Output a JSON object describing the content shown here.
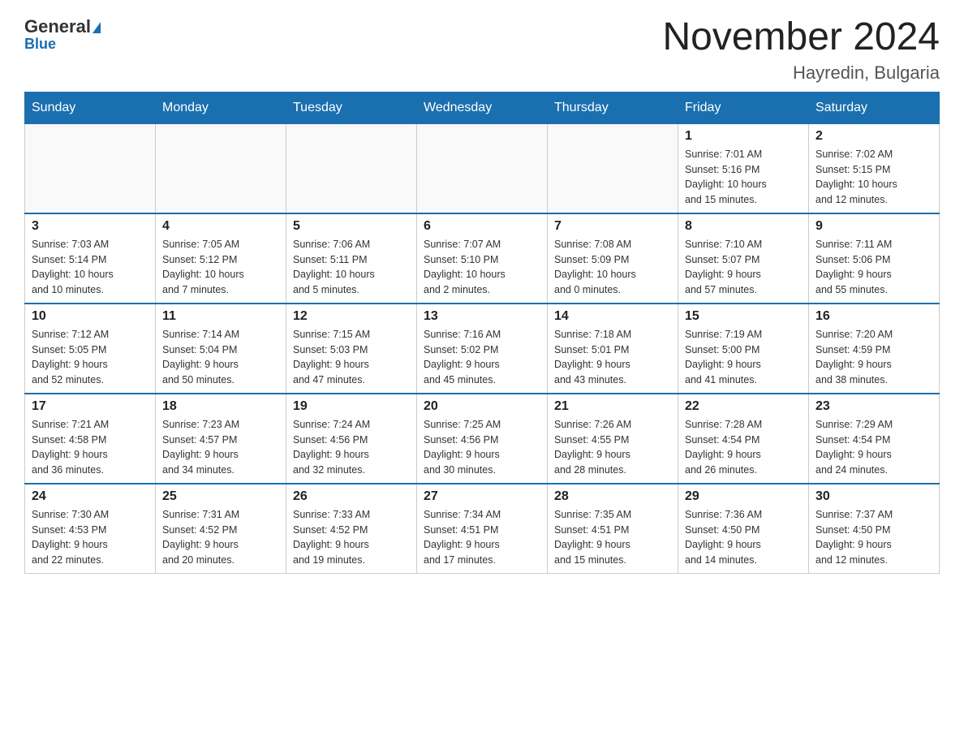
{
  "header": {
    "logo_general": "General",
    "logo_blue": "Blue",
    "main_title": "November 2024",
    "subtitle": "Hayredin, Bulgaria"
  },
  "weekdays": [
    "Sunday",
    "Monday",
    "Tuesday",
    "Wednesday",
    "Thursday",
    "Friday",
    "Saturday"
  ],
  "weeks": [
    [
      {
        "day": "",
        "info": ""
      },
      {
        "day": "",
        "info": ""
      },
      {
        "day": "",
        "info": ""
      },
      {
        "day": "",
        "info": ""
      },
      {
        "day": "",
        "info": ""
      },
      {
        "day": "1",
        "info": "Sunrise: 7:01 AM\nSunset: 5:16 PM\nDaylight: 10 hours\nand 15 minutes."
      },
      {
        "day": "2",
        "info": "Sunrise: 7:02 AM\nSunset: 5:15 PM\nDaylight: 10 hours\nand 12 minutes."
      }
    ],
    [
      {
        "day": "3",
        "info": "Sunrise: 7:03 AM\nSunset: 5:14 PM\nDaylight: 10 hours\nand 10 minutes."
      },
      {
        "day": "4",
        "info": "Sunrise: 7:05 AM\nSunset: 5:12 PM\nDaylight: 10 hours\nand 7 minutes."
      },
      {
        "day": "5",
        "info": "Sunrise: 7:06 AM\nSunset: 5:11 PM\nDaylight: 10 hours\nand 5 minutes."
      },
      {
        "day": "6",
        "info": "Sunrise: 7:07 AM\nSunset: 5:10 PM\nDaylight: 10 hours\nand 2 minutes."
      },
      {
        "day": "7",
        "info": "Sunrise: 7:08 AM\nSunset: 5:09 PM\nDaylight: 10 hours\nand 0 minutes."
      },
      {
        "day": "8",
        "info": "Sunrise: 7:10 AM\nSunset: 5:07 PM\nDaylight: 9 hours\nand 57 minutes."
      },
      {
        "day": "9",
        "info": "Sunrise: 7:11 AM\nSunset: 5:06 PM\nDaylight: 9 hours\nand 55 minutes."
      }
    ],
    [
      {
        "day": "10",
        "info": "Sunrise: 7:12 AM\nSunset: 5:05 PM\nDaylight: 9 hours\nand 52 minutes."
      },
      {
        "day": "11",
        "info": "Sunrise: 7:14 AM\nSunset: 5:04 PM\nDaylight: 9 hours\nand 50 minutes."
      },
      {
        "day": "12",
        "info": "Sunrise: 7:15 AM\nSunset: 5:03 PM\nDaylight: 9 hours\nand 47 minutes."
      },
      {
        "day": "13",
        "info": "Sunrise: 7:16 AM\nSunset: 5:02 PM\nDaylight: 9 hours\nand 45 minutes."
      },
      {
        "day": "14",
        "info": "Sunrise: 7:18 AM\nSunset: 5:01 PM\nDaylight: 9 hours\nand 43 minutes."
      },
      {
        "day": "15",
        "info": "Sunrise: 7:19 AM\nSunset: 5:00 PM\nDaylight: 9 hours\nand 41 minutes."
      },
      {
        "day": "16",
        "info": "Sunrise: 7:20 AM\nSunset: 4:59 PM\nDaylight: 9 hours\nand 38 minutes."
      }
    ],
    [
      {
        "day": "17",
        "info": "Sunrise: 7:21 AM\nSunset: 4:58 PM\nDaylight: 9 hours\nand 36 minutes."
      },
      {
        "day": "18",
        "info": "Sunrise: 7:23 AM\nSunset: 4:57 PM\nDaylight: 9 hours\nand 34 minutes."
      },
      {
        "day": "19",
        "info": "Sunrise: 7:24 AM\nSunset: 4:56 PM\nDaylight: 9 hours\nand 32 minutes."
      },
      {
        "day": "20",
        "info": "Sunrise: 7:25 AM\nSunset: 4:56 PM\nDaylight: 9 hours\nand 30 minutes."
      },
      {
        "day": "21",
        "info": "Sunrise: 7:26 AM\nSunset: 4:55 PM\nDaylight: 9 hours\nand 28 minutes."
      },
      {
        "day": "22",
        "info": "Sunrise: 7:28 AM\nSunset: 4:54 PM\nDaylight: 9 hours\nand 26 minutes."
      },
      {
        "day": "23",
        "info": "Sunrise: 7:29 AM\nSunset: 4:54 PM\nDaylight: 9 hours\nand 24 minutes."
      }
    ],
    [
      {
        "day": "24",
        "info": "Sunrise: 7:30 AM\nSunset: 4:53 PM\nDaylight: 9 hours\nand 22 minutes."
      },
      {
        "day": "25",
        "info": "Sunrise: 7:31 AM\nSunset: 4:52 PM\nDaylight: 9 hours\nand 20 minutes."
      },
      {
        "day": "26",
        "info": "Sunrise: 7:33 AM\nSunset: 4:52 PM\nDaylight: 9 hours\nand 19 minutes."
      },
      {
        "day": "27",
        "info": "Sunrise: 7:34 AM\nSunset: 4:51 PM\nDaylight: 9 hours\nand 17 minutes."
      },
      {
        "day": "28",
        "info": "Sunrise: 7:35 AM\nSunset: 4:51 PM\nDaylight: 9 hours\nand 15 minutes."
      },
      {
        "day": "29",
        "info": "Sunrise: 7:36 AM\nSunset: 4:50 PM\nDaylight: 9 hours\nand 14 minutes."
      },
      {
        "day": "30",
        "info": "Sunrise: 7:37 AM\nSunset: 4:50 PM\nDaylight: 9 hours\nand 12 minutes."
      }
    ]
  ]
}
